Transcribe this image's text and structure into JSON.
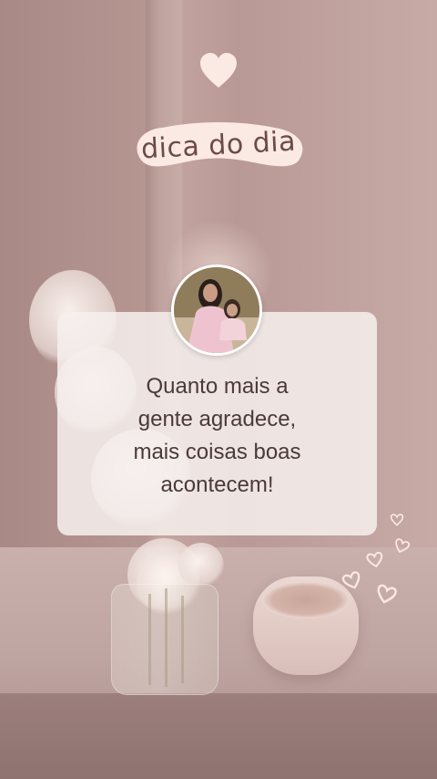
{
  "badge": {
    "label": "dica do dia"
  },
  "quote": {
    "lines": [
      "Quanto mais a",
      "gente agradece,",
      "mais coisas boas",
      "acontecem!"
    ]
  },
  "colors": {
    "background": "#b5938e",
    "badge_fill": "#fbe9e3",
    "badge_text": "#6b4b47",
    "card_fill": "#f6f0ee",
    "quote_text": "#4a3a38",
    "heart_fill": "#fbe9e3"
  },
  "icons": {
    "top": "heart-icon",
    "avatar": "profile-photo",
    "decorations": "outline-heart-icon"
  }
}
